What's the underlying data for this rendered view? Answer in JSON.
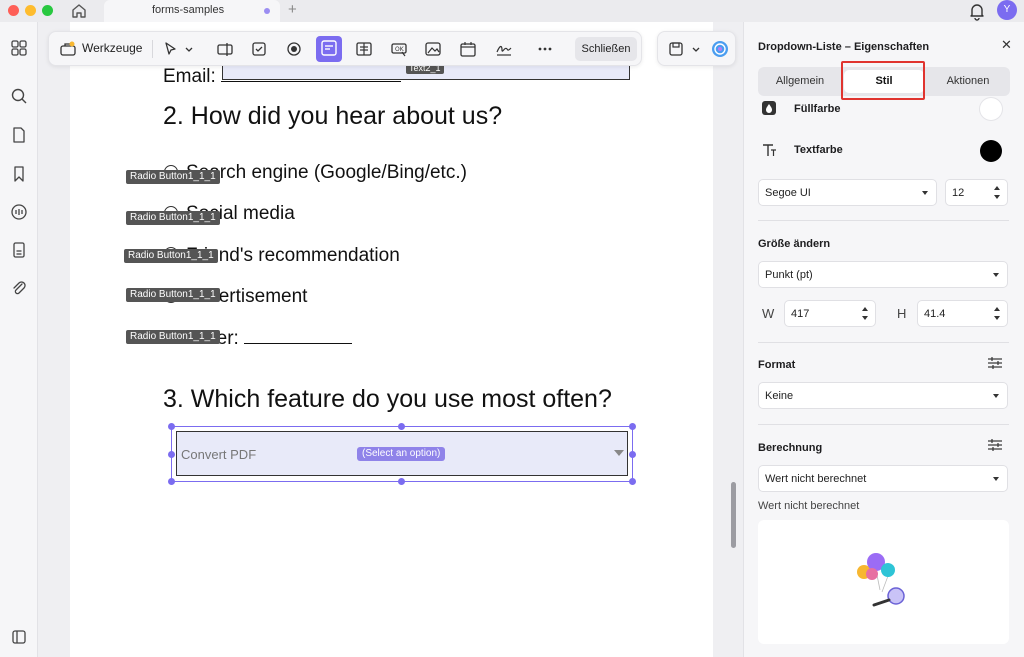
{
  "titlebar": {
    "tab_label": "forms-samples",
    "avatar_initial": "Y"
  },
  "toolbar": {
    "tools_label": "Werkzeuge",
    "close_label": "Schließen"
  },
  "document": {
    "email_label": "Email:",
    "textfield_tag": "Text2_1",
    "q2_heading": "2. How did you hear about us?",
    "options": [
      {
        "text": "Search engine (Google/Bing/etc.)",
        "tag": "Radio Button1_1_1"
      },
      {
        "text": "Social media",
        "tag": "Radio Button1_1_1"
      },
      {
        "text": "Friend's recommendation",
        "tag": "Radio Button1_1_1"
      },
      {
        "text": "Advertisement",
        "tag": "Radio Button1_1_1"
      },
      {
        "text": "Other:",
        "tag": "Radio Button1_1_1"
      }
    ],
    "q3_heading": "3. Which feature do you use most often?",
    "dropdown_value": "Convert PDF",
    "dropdown_hint": "(Select an option)"
  },
  "panel": {
    "title": "Dropdown-Liste – Eigenschaften",
    "tabs": [
      "Allgemein",
      "Stil",
      "Aktionen"
    ],
    "active_tab": "Stil",
    "fill_color_label": "Füllfarbe",
    "fill_color": "#ffffff",
    "text_color_label": "Textfarbe",
    "text_color": "#000000",
    "font_family": "Segoe UI",
    "font_size": "12",
    "resize_label": "Größe ändern",
    "unit": "Punkt (pt)",
    "width_label": "W",
    "width_value": "417",
    "height_label": "H",
    "height_value": "41.4",
    "format_label": "Format",
    "format_value": "Keine",
    "calc_label": "Berechnung",
    "calc_value": "Wert nicht berechnet",
    "calc_caption": "Wert nicht berechnet"
  },
  "colors": {
    "accent": "#7b6cf0",
    "highlight": "#e0342f"
  }
}
